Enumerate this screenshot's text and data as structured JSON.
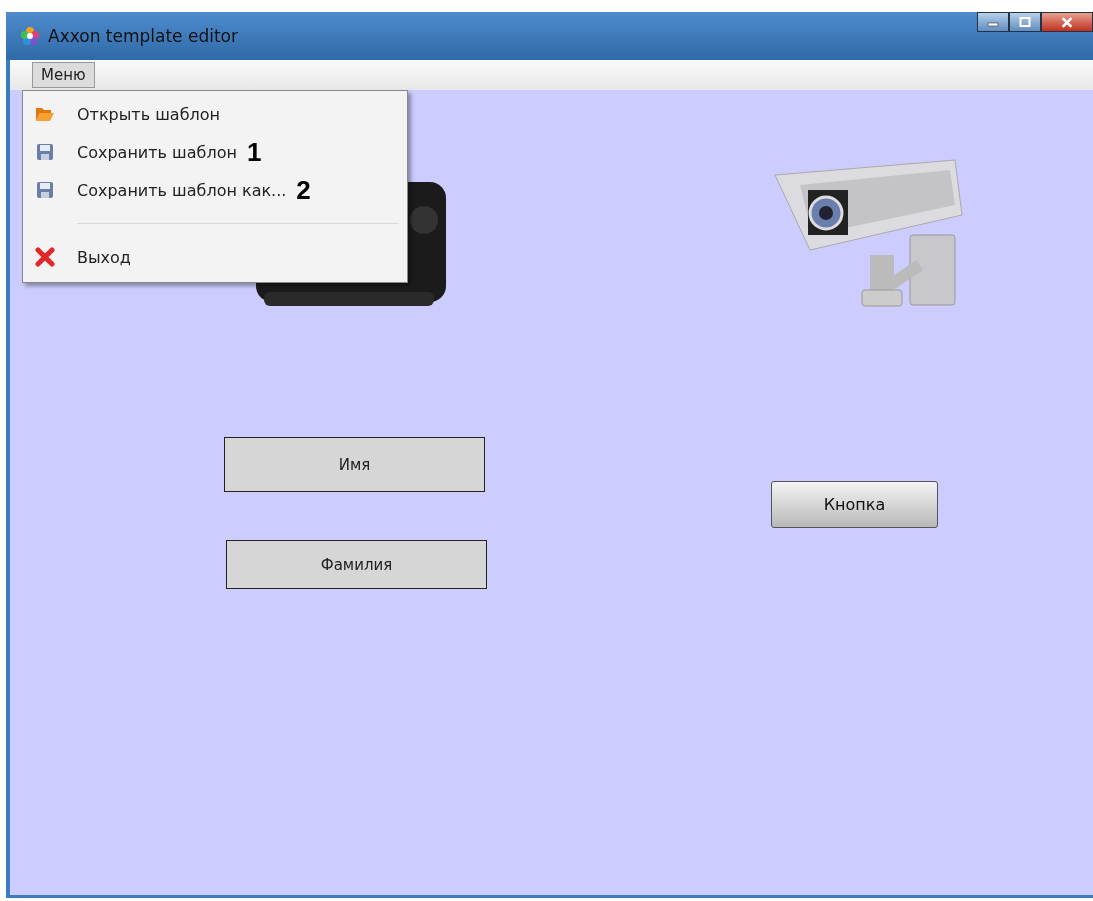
{
  "window": {
    "title": "Axxon template editor"
  },
  "menu_bar": {
    "label": "Меню",
    "open": true
  },
  "menu": [
    {
      "kind": "open",
      "label": "Открыть шаблон"
    },
    {
      "kind": "save",
      "label": "Сохранить шаблон",
      "callout": "1"
    },
    {
      "kind": "save",
      "label": "Сохранить шаблон как...",
      "callout": "2"
    },
    {
      "kind": "separator"
    },
    {
      "kind": "exit",
      "label": "Выход"
    }
  ],
  "canvas": {
    "fields": [
      "Имя",
      "Фамилия"
    ],
    "button": "Кнопка"
  }
}
